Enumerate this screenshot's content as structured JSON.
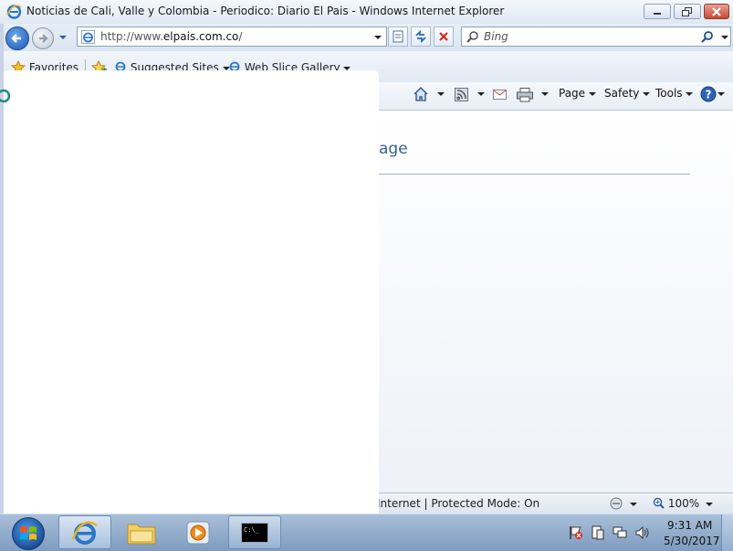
{
  "window": {
    "title": "Noticias de Cali, Valle y Colombia - Periodico: Diario El Pais - Windows Internet Explorer"
  },
  "addressbar": {
    "url_prefix": "http://www.",
    "url_domain": "elpais.com.co",
    "url_suffix": "/"
  },
  "search": {
    "placeholder": "Bing"
  },
  "favorites_bar": {
    "favorites_label": "Favorites",
    "items": [
      {
        "label": "Suggested Sites"
      },
      {
        "label": "Web Slice Gallery"
      }
    ]
  },
  "command_bar": {
    "page_label": "Page",
    "safety_label": "Safety",
    "tools_label": "Tools"
  },
  "content": {
    "heading_fragment": "age"
  },
  "statusbar": {
    "zone_text": "Internet | Protected Mode: On",
    "zoom_text": "100%"
  },
  "taskbar": {
    "clock_time": "9:31 AM",
    "clock_date": "5/30/2017",
    "pinned": [
      "internet-explorer",
      "windows-explorer",
      "media-player",
      "command-prompt"
    ]
  },
  "colors": {
    "titlebar": "#dfe8f3",
    "link_heading": "#3a5f91",
    "taskbar": "#8ea9c9"
  }
}
